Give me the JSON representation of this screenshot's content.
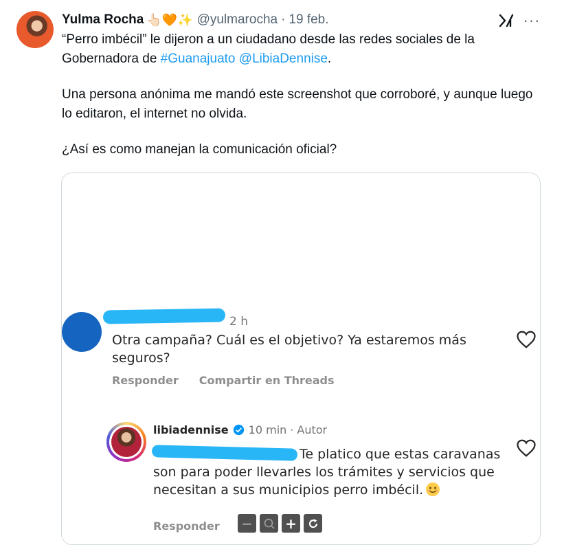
{
  "tweet": {
    "author_name": "Yulma Rocha",
    "author_emojis": "👆🏻🧡✨",
    "handle": "@yulmarocha",
    "separator": "·",
    "date": "19 feb.",
    "more_label": "···",
    "paragraph1_start": "“Perro imbécil” le dijeron a un ciudadano desde las redes sociales de la Gobernadora de ",
    "hashtag": "#Guanajuato",
    "mention": "@LibiaDennise",
    "paragraph1_end": ".",
    "paragraph2": "Una persona anónima me mandó este screenshot que corroboré, y aunque luego lo editaron, el internet no olvida.",
    "paragraph3": "¿Así es como manejan la comunicación oficial?"
  },
  "screenshot": {
    "comment1": {
      "time": "2 h",
      "text": "Otra campaña? Cuál es el objetivo? Ya estaremos más seguros?",
      "reply_label": "Responder",
      "share_label": "Compartir en Threads"
    },
    "reply": {
      "username": "libiadennise",
      "time": "10 min",
      "separator": "·",
      "author_label": "Autor",
      "text": "Te platico que estas caravanas son para poder llevarles los trámites y servicios que necesitan a sus municipios perro imbécil.",
      "reply_label": "Responder"
    },
    "viewer_controls": [
      "−",
      "🔍",
      "+",
      "↻"
    ]
  },
  "colors": {
    "link": "#1d9bf0",
    "muted": "#536471",
    "scribble": "#29b6f6",
    "verified": "#0095f6"
  }
}
